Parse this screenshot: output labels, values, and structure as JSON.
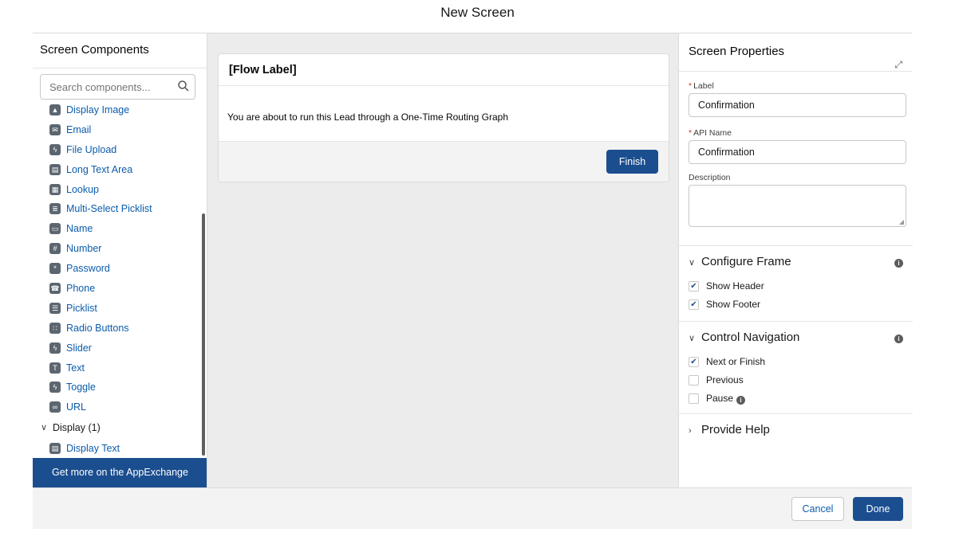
{
  "modal": {
    "title": "New Screen"
  },
  "left_panel": {
    "title": "Screen Components",
    "search_placeholder": "Search components...",
    "items": [
      {
        "label": "Display Image",
        "icon": "image-icon"
      },
      {
        "label": "Email",
        "icon": "email-icon"
      },
      {
        "label": "File Upload",
        "icon": "bolt-icon"
      },
      {
        "label": "Long Text Area",
        "icon": "textarea-icon"
      },
      {
        "label": "Lookup",
        "icon": "lookup-icon"
      },
      {
        "label": "Multi-Select Picklist",
        "icon": "multi-picklist-icon"
      },
      {
        "label": "Name",
        "icon": "name-icon"
      },
      {
        "label": "Number",
        "icon": "number-icon"
      },
      {
        "label": "Password",
        "icon": "password-icon"
      },
      {
        "label": "Phone",
        "icon": "phone-icon"
      },
      {
        "label": "Picklist",
        "icon": "picklist-icon"
      },
      {
        "label": "Radio Buttons",
        "icon": "radio-icon"
      },
      {
        "label": "Slider",
        "icon": "bolt-icon"
      },
      {
        "label": "Text",
        "icon": "text-icon"
      },
      {
        "label": "Toggle",
        "icon": "bolt-icon"
      },
      {
        "label": "URL",
        "icon": "link-icon"
      }
    ],
    "display_section": "Display (1)",
    "display_items": [
      {
        "label": "Display Text",
        "icon": "display-text-icon"
      }
    ],
    "appexchange": "Get more on the AppExchange"
  },
  "canvas": {
    "header": "[Flow Label]",
    "body": "You are about to run this Lead through a One-Time Routing Graph",
    "finish_label": "Finish"
  },
  "right_panel": {
    "title": "Screen Properties",
    "label_label": "Label",
    "label_value": "Confirmation",
    "api_label": "API Name",
    "api_value": "Confirmation",
    "description_label": "Description",
    "configure_frame": {
      "title": "Configure Frame",
      "options": [
        {
          "label": "Show Header",
          "checked": true
        },
        {
          "label": "Show Footer",
          "checked": true
        }
      ]
    },
    "control_navigation": {
      "title": "Control Navigation",
      "options": [
        {
          "label": "Next or Finish",
          "checked": true
        },
        {
          "label": "Previous",
          "checked": false
        },
        {
          "label": "Pause",
          "checked": false
        }
      ]
    },
    "provide_help": "Provide Help"
  },
  "footer": {
    "cancel_label": "Cancel",
    "done_label": "Done"
  },
  "colors": {
    "brand": "#1b4e8f",
    "link": "#0b5cab"
  }
}
